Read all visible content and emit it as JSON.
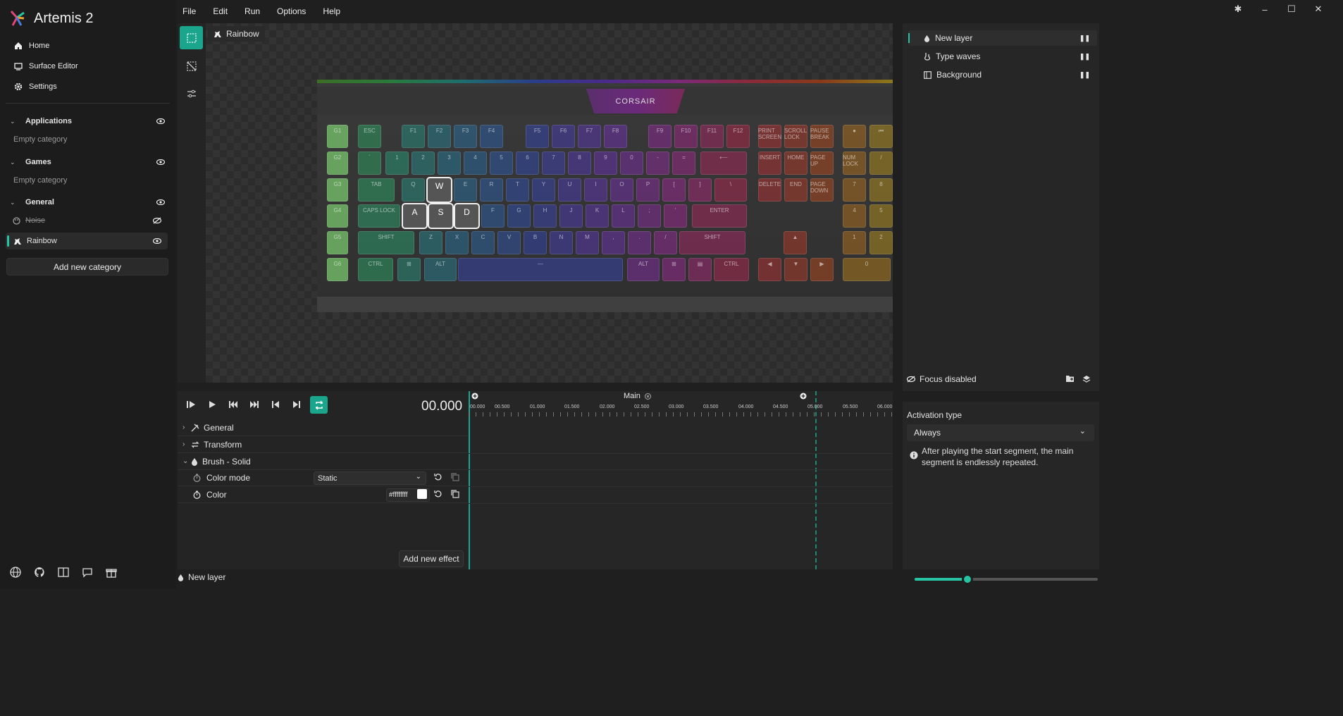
{
  "app": {
    "title": "Artemis 2"
  },
  "menu": [
    "File",
    "Edit",
    "Run",
    "Options",
    "Help"
  ],
  "sidebar": {
    "nav": [
      {
        "label": "Home",
        "icon": "home-icon"
      },
      {
        "label": "Surface Editor",
        "icon": "surface-editor-icon"
      },
      {
        "label": "Settings",
        "icon": "gear-icon"
      }
    ],
    "categories": [
      {
        "name": "Applications",
        "empty": "Empty category"
      },
      {
        "name": "Games",
        "empty": "Empty category"
      },
      {
        "name": "General"
      }
    ],
    "profiles": [
      {
        "name": "Noise",
        "disabled": true
      },
      {
        "name": "Rainbow",
        "selected": true
      }
    ],
    "add_category": "Add new category"
  },
  "editor": {
    "profile_name": "Rainbow",
    "brand": "CORSAIR"
  },
  "keyboard": {
    "rows": [
      [
        "G1",
        "ESC",
        "F1",
        "F2",
        "F3",
        "F4",
        "F5",
        "F6",
        "F7",
        "F8",
        "F9",
        "F10",
        "F11",
        "F12",
        "PRINT SCREEN",
        "SCROLL LOCK",
        "PAUSE BREAK",
        "●",
        "⏮"
      ],
      [
        "G2",
        "`",
        "1",
        "2",
        "3",
        "4",
        "5",
        "6",
        "7",
        "8",
        "9",
        "0",
        "-",
        "=",
        "⟵",
        "INSERT",
        "HOME",
        "PAGE UP",
        "NUM LOCK",
        "/"
      ],
      [
        "G3",
        "TAB",
        "Q",
        "W",
        "E",
        "R",
        "T",
        "Y",
        "U",
        "I",
        "O",
        "P",
        "[",
        "]",
        "\\",
        "DELETE",
        "END",
        "PAGE DOWN",
        "7",
        "8"
      ],
      [
        "G4",
        "CAPS LOCK",
        "A",
        "S",
        "D",
        "F",
        "G",
        "H",
        "J",
        "K",
        "L",
        ";",
        "'",
        "ENTER",
        "4",
        "5"
      ],
      [
        "G5",
        "SHIFT",
        "Z",
        "X",
        "C",
        "V",
        "B",
        "N",
        "M",
        ",",
        ".",
        "/",
        "SHIFT",
        "▲",
        "1",
        "2"
      ],
      [
        "G6",
        "CTRL",
        "⊞",
        "ALT",
        "—",
        "ALT",
        "⊞",
        "▤",
        "CTRL",
        "◀",
        "▼",
        "▶",
        "0"
      ]
    ]
  },
  "timeline": {
    "timecode": "00.000",
    "segment": "Main",
    "ruler": [
      "00.000",
      "00.500",
      "01.000",
      "01.500",
      "02.000",
      "02.500",
      "03.000",
      "03.500",
      "04.000",
      "04.500",
      "05.000",
      "05.500",
      "06.000"
    ],
    "properties": {
      "general": "General",
      "transform": "Transform",
      "brush": "Brush - Solid",
      "color_mode": "Color mode",
      "color_mode_value": "Static",
      "color": "Color",
      "color_value": "#ffffffff"
    },
    "add_effect": "Add new effect"
  },
  "layers": [
    {
      "name": "New layer",
      "icon": "droplet-icon",
      "selected": true
    },
    {
      "name": "Type waves",
      "icon": "waves-icon"
    },
    {
      "name": "Background",
      "icon": "background-icon"
    }
  ],
  "focus": "Focus disabled",
  "activation": {
    "title": "Activation type",
    "value": "Always",
    "info": "After playing the start segment, the main segment is endlessly repeated."
  },
  "status": {
    "layer": "New layer"
  },
  "zoom": {
    "level": 0.29
  },
  "colors": {
    "accent": "#1aa58c"
  }
}
